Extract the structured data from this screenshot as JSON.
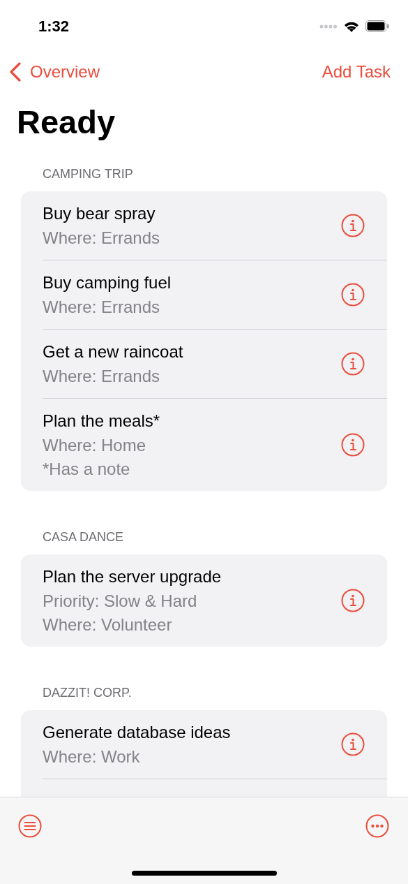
{
  "status_bar": {
    "time": "1:32"
  },
  "nav": {
    "back": "Overview",
    "action": "Add Task"
  },
  "title": "Ready",
  "sections": [
    {
      "header": "CAMPING TRIP",
      "cut_off": false,
      "items": [
        {
          "title": "Buy bear spray",
          "details": [
            "Where: Errands"
          ]
        },
        {
          "title": "Buy camping fuel",
          "details": [
            "Where: Errands"
          ]
        },
        {
          "title": "Get a new raincoat",
          "details": [
            "Where: Errands"
          ]
        },
        {
          "title": "Plan the meals*",
          "details": [
            "Where: Home",
            "*Has a note"
          ]
        }
      ]
    },
    {
      "header": "CASA DANCE",
      "cut_off": false,
      "items": [
        {
          "title": "Plan the server upgrade",
          "details": [
            "Priority: Slow & Hard",
            "Where: Volunteer"
          ]
        }
      ]
    },
    {
      "header": "DAZZIT! CORP.",
      "cut_off": true,
      "items": [
        {
          "title": "Generate database ideas",
          "details": [
            "Where: Work"
          ]
        }
      ]
    }
  ]
}
